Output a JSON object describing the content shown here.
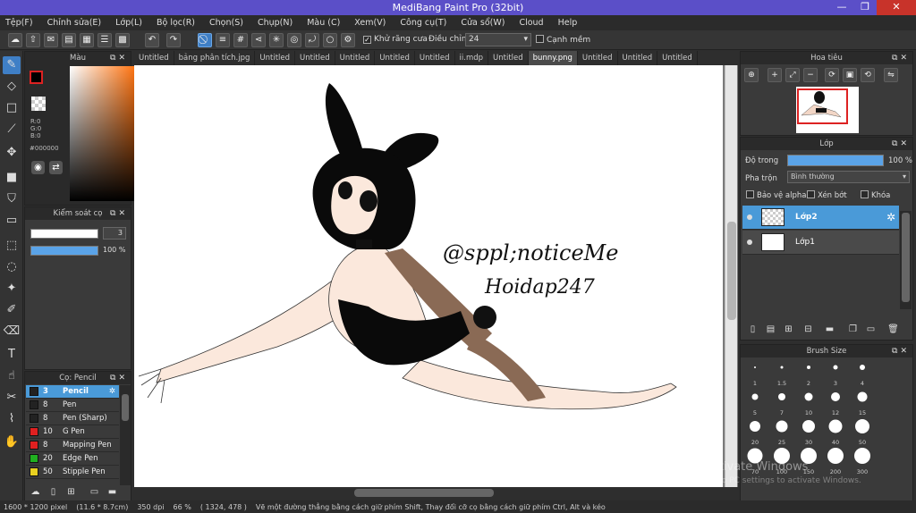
{
  "window": {
    "title": "MediBang Paint Pro (32bit)",
    "minimize": "—",
    "restore": "❐",
    "close": "✕"
  },
  "menu": [
    "Tệp(F)",
    "Chỉnh sửa(E)",
    "Lớp(L)",
    "Bộ lọc(R)",
    "Chọn(S)",
    "Chụp(N)",
    "Màu (C)",
    "Xem(V)",
    "Công cụ(T)",
    "Cửa sổ(W)",
    "Cloud",
    "Help"
  ],
  "toolbar": {
    "antialias_label": "Khử răng cưa",
    "correction_label": "Điều chỉnh",
    "correction_value": "24",
    "edge_label": "Cạnh mềm"
  },
  "color_panel": {
    "title": "Màu",
    "r": "R:0",
    "g": "G:0",
    "b": "B:0",
    "hex": "#000000",
    "fg": "#000000",
    "bg": "#ffffff"
  },
  "brush_control": {
    "title": "Kiểm soát cọ",
    "size": "3",
    "opacity": "100 %"
  },
  "brush_list": {
    "title": "Cọ: Pencil",
    "items": [
      {
        "size": "3",
        "name": "Pencil",
        "color": "#222222",
        "selected": true
      },
      {
        "size": "8",
        "name": "Pen",
        "color": "#222222"
      },
      {
        "size": "8",
        "name": "Pen (Sharp)",
        "color": "#222222"
      },
      {
        "size": "10",
        "name": "G Pen",
        "color": "#e02020"
      },
      {
        "size": "8",
        "name": "Mapping Pen",
        "color": "#e02020"
      },
      {
        "size": "20",
        "name": "Edge Pen",
        "color": "#20b020"
      },
      {
        "size": "50",
        "name": "Stipple Pen",
        "color": "#e8d020"
      }
    ]
  },
  "tabs": [
    "Untitled",
    "bảng phân tích.jpg",
    "Untitled",
    "Untitled",
    "Untitled",
    "Untitled",
    "Untitled",
    "ii.mdp",
    "Untitled",
    "bunny.png",
    "Untitled",
    "Untitled",
    "Untitled"
  ],
  "active_tab": 9,
  "canvas_text": {
    "line1": "@sppl;noticeMe",
    "line2": "Hoidap247"
  },
  "navigator": {
    "title": "Hoa tiêu"
  },
  "layer_panel": {
    "title": "Lớp",
    "opacity_label": "Độ trong",
    "opacity_value": "100 %",
    "blend_label": "Pha trộn",
    "blend_value": "Bình thường",
    "protect_alpha": "Bảo vệ alpha",
    "clipping": "Xén bớt",
    "lock": "Khóa",
    "layers": [
      {
        "name": "Lớp2",
        "selected": true
      },
      {
        "name": "Lớp1",
        "selected": false
      }
    ]
  },
  "brush_size": {
    "title": "Brush Size",
    "sizes": [
      "1",
      "1.5",
      "2",
      "3",
      "4",
      "5",
      "7",
      "10",
      "12",
      "15",
      "20",
      "25",
      "30",
      "40",
      "50",
      "70",
      "100",
      "150",
      "200",
      "300"
    ]
  },
  "watermark": {
    "line1": "Activate Windows",
    "line2": "Go to PC settings to activate Windows."
  },
  "status": {
    "size": "1600 * 1200 pixel",
    "physical": "(11.6 * 8.7cm)",
    "dpi": "350 dpi",
    "zoom": "66 %",
    "coords": "( 1324, 478 )",
    "hint": "Vẽ một đường thẳng bằng cách giữ phím Shift, Thay đổi cỡ cọ bằng cách giữ phím Ctrl, Alt và kéo"
  }
}
